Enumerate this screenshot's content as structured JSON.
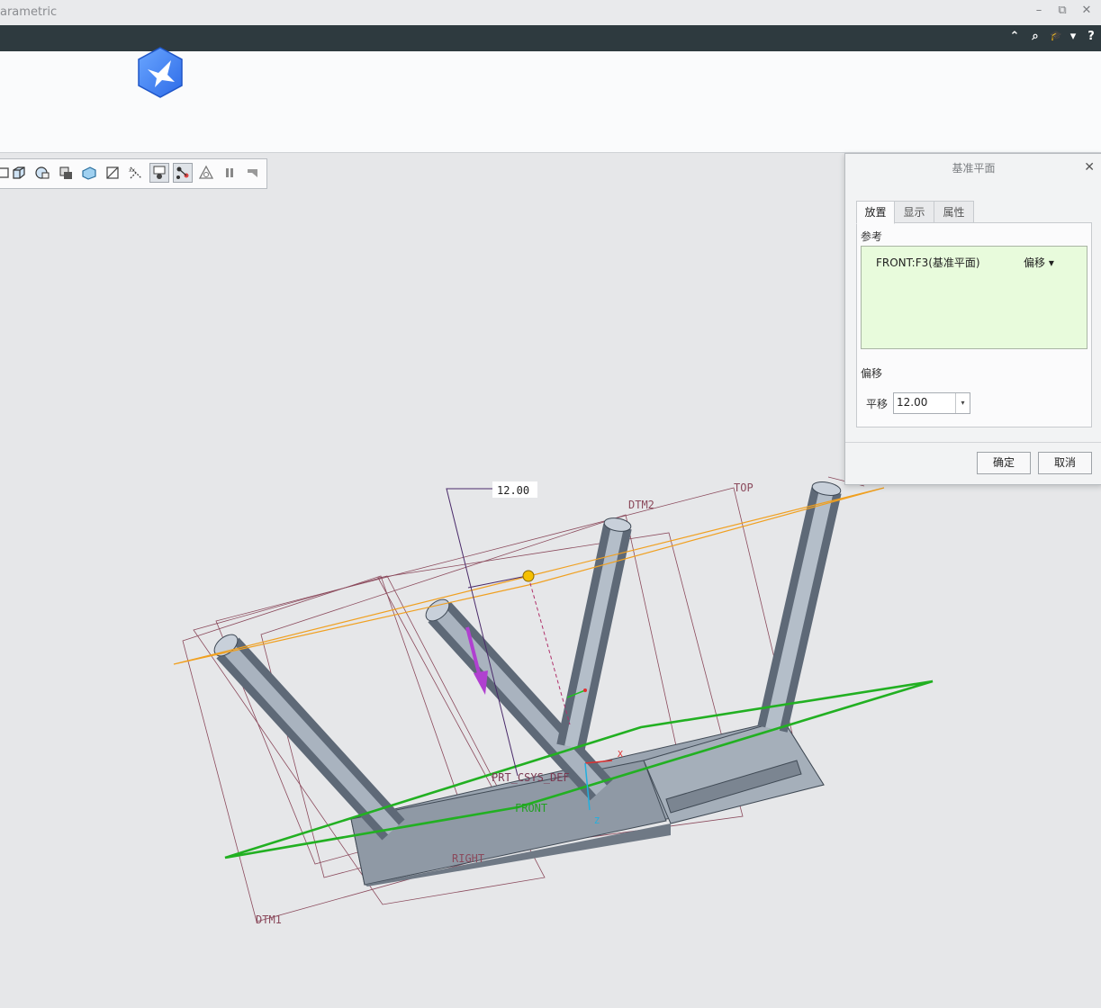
{
  "window": {
    "title": "arametric"
  },
  "window_controls": {
    "minimize": "–",
    "restore": "⧉",
    "close": "✕"
  },
  "top_bar": {
    "collapse_glyph": "⌃",
    "search_glyph": "⌕",
    "learn_glyph": "🎓",
    "dropdown_glyph": "▾",
    "help_glyph": "?"
  },
  "viewport": {
    "labels": {
      "dim": "12.00",
      "top": "TOP",
      "dtm2": "DTM2",
      "csys": "PRT_CSYS_DEF",
      "front": "FRONT",
      "right": "RIGHT",
      "dtm1": "DTM1",
      "x_axis": "X",
      "z_axis": "Z"
    },
    "colors": {
      "background": "#e6e7e9",
      "part_body": "#9aa4b0",
      "new_plane": "#f0a020",
      "reference_plane": "#22b022",
      "datum_planes": "#8b4a5c",
      "drag_handle": "#f5c000",
      "direction_arrow": "#b040d0"
    }
  },
  "dialog": {
    "title": "基准平面",
    "close_glyph": "✕",
    "tabs": [
      {
        "label": "放置"
      },
      {
        "label": "显示"
      },
      {
        "label": "属性"
      }
    ],
    "references_label": "参考",
    "reference": {
      "name": "FRONT:F3(基准平面)",
      "constraint": "偏移 ▾"
    },
    "offset_label": "偏移",
    "translation_label": "平移",
    "translation_value": "12.00",
    "dropdown_glyph": "▾",
    "ok_label": "确定",
    "cancel_label": "取消"
  }
}
